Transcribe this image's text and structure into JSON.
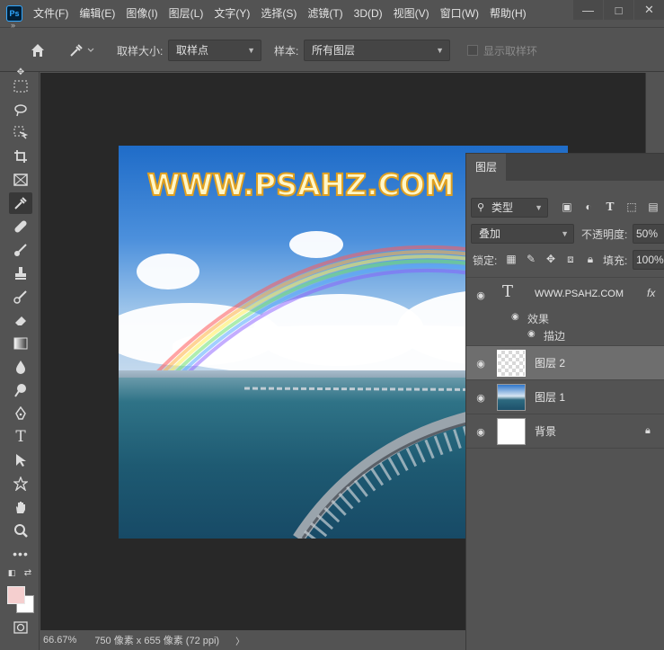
{
  "app": {
    "logo": "Ps"
  },
  "menu": [
    "文件(F)",
    "编辑(E)",
    "图像(I)",
    "图层(L)",
    "文字(Y)",
    "选择(S)",
    "滤镜(T)",
    "3D(D)",
    "视图(V)",
    "窗口(W)",
    "帮助(H)"
  ],
  "window_controls": {
    "minimize": "—",
    "restore": "□",
    "close": "✕"
  },
  "options": {
    "sample_size_label": "取样大小:",
    "sample_size_value": "取样点",
    "sample_label": "样本:",
    "sample_value": "所有图层",
    "show_ring_label": "显示取样环"
  },
  "document": {
    "watermark": "WWW.PSAHZ.COM"
  },
  "layers_panel": {
    "tab": "图层",
    "filter_value": "类型",
    "blend_mode": "叠加",
    "opacity_label": "不透明度:",
    "opacity_value": "50%",
    "lock_label": "锁定:",
    "fill_label": "填充:",
    "fill_value": "100%",
    "text_layer": {
      "name": "WWW.PSAHZ.COM",
      "fx": "fx",
      "effects_label": "效果",
      "stroke_label": "描边"
    },
    "layers": [
      {
        "name": "图层 2",
        "selected": true
      },
      {
        "name": "图层 1",
        "selected": false
      },
      {
        "name": "背景",
        "selected": false
      }
    ]
  },
  "status": {
    "zoom": "66.67%",
    "doc_info": "750 像素 x 655 像素 (72 ppi)",
    "arrow": "〉"
  },
  "colors": {
    "foreground": "#f5cfcf",
    "background": "#ffffff",
    "ui_panel": "#535353",
    "canvas_bg": "#282828"
  }
}
